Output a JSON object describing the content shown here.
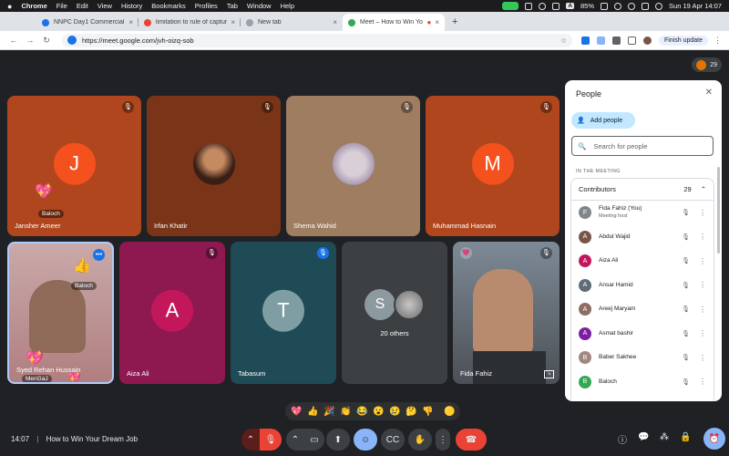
{
  "menubar": {
    "apple": "",
    "app": "Chrome",
    "items": [
      "File",
      "Edit",
      "View",
      "History",
      "Bookmarks",
      "Profiles",
      "Tab",
      "Window",
      "Help"
    ],
    "kb": "A",
    "battery": "85%",
    "datetime": "Sun 19 Apr  14:07"
  },
  "tabs": [
    {
      "title": "NNPC Day1 Commercial Cont...",
      "color": "#1a73e8"
    },
    {
      "title": "limitation to rule of capture o...",
      "color": "#ea4335"
    },
    {
      "title": "New tab",
      "color": "#9aa0a6"
    },
    {
      "title": "Meet – How to Win Your D...",
      "color": "#34a853"
    }
  ],
  "newtab": "+",
  "address": {
    "url": "https://meet.google.com/jvh-oizq-sob",
    "finish_update": "Finish update"
  },
  "meet": {
    "participant_count": "29",
    "tiles": [
      {
        "name": "Jansher Ameer",
        "initial": "J",
        "bg": "#b0461d",
        "avatar_color": "#f4511e",
        "chip": "Baloch",
        "emoji": "💖"
      },
      {
        "name": "Irfan Khatir",
        "bg": "#7a3417"
      },
      {
        "name": "Shema Wahid",
        "bg": "#9e7d61"
      },
      {
        "name": "Muhammad Hasnain",
        "initial": "M",
        "bg": "#b0461d",
        "avatar_color": "#f4511e"
      },
      {
        "name": "Syed Rehan Hussain",
        "chip": "Baloch",
        "chip2": "MenGaJ",
        "emoji": "👍",
        "emoji2": "💖",
        "emoji3": "💖"
      },
      {
        "name": "Aiza Ali",
        "initial": "A",
        "bg": "#8e1850",
        "avatar_color": "#c2185b"
      },
      {
        "name": "Tabasum",
        "initial": "T",
        "bg": "#1e4b55",
        "avatar_color": "#7f9ea3"
      },
      {
        "name": "20 others",
        "initial": "S",
        "bg": "#3c4043",
        "avatar_color": "#8c9aa0"
      },
      {
        "name": "Fida Fahiz",
        "bg": "#59616a"
      }
    ]
  },
  "people_panel": {
    "title": "People",
    "add_people": "Add people",
    "search_placeholder": "Search for people",
    "in_meeting": "IN THE MEETING",
    "contributors_label": "Contributors",
    "contributors_count": "29",
    "people": [
      {
        "name": "Fida Fahiz (You)",
        "sub": "Meeting host",
        "initial": "F",
        "color": "#80868b"
      },
      {
        "name": "Abdul Wajid",
        "initial": "A",
        "color": "#795548"
      },
      {
        "name": "Aiza Ali",
        "initial": "A",
        "color": "#c2185b"
      },
      {
        "name": "Ansar Hamid",
        "initial": "A",
        "color": "#5f6b76"
      },
      {
        "name": "Areej Maryam",
        "initial": "A",
        "color": "#8d6e63"
      },
      {
        "name": "Asmat bashir",
        "initial": "A",
        "color": "#7b1fa2"
      },
      {
        "name": "Baber Sakhee",
        "initial": "B",
        "color": "#a1887f"
      },
      {
        "name": "Baloch",
        "initial": "B",
        "color": "#33a853"
      }
    ]
  },
  "reactions": [
    "💖",
    "👍",
    "🎉",
    "👏",
    "😂",
    "😮",
    "😢",
    "🤔",
    "👎",
    "🟡"
  ],
  "bottom": {
    "time": "14:07",
    "meeting_title": "How to Win Your Dream Job"
  }
}
